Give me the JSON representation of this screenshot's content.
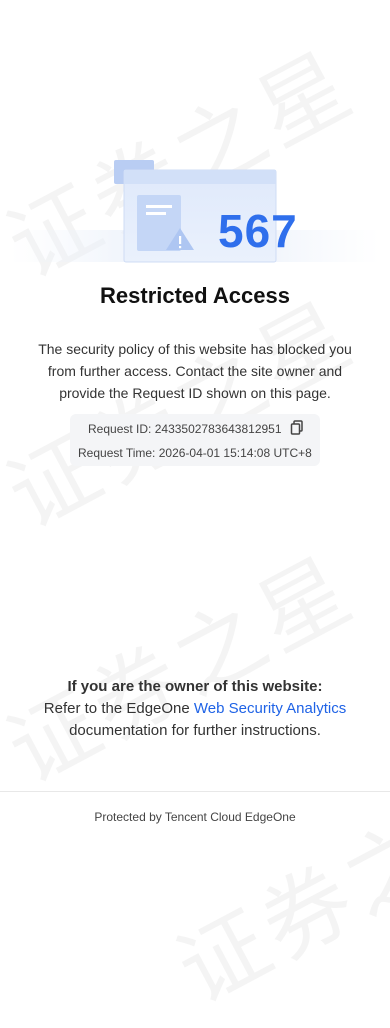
{
  "watermark": "证券之星",
  "error": {
    "code": "567",
    "title": "Restricted Access",
    "description": "The security policy of this website has blocked you from further access. Contact the site owner and provide the Request ID shown on this page."
  },
  "request": {
    "id_label": "Request ID:",
    "id_value": "2433502783643812951",
    "time_label": "Request Time:",
    "time_value": "2026-04-01 15:14:08 UTC+8",
    "copy_icon": "copy-icon"
  },
  "owner": {
    "heading": "If you are the owner of this website:",
    "prefix": "Refer to the EdgeOne",
    "link_text": "Web Security Analytics",
    "suffix": "documentation for further instructions."
  },
  "footer": {
    "text": "Protected by Tencent Cloud EdgeOne"
  },
  "colors": {
    "accent": "#2f6fec",
    "link": "#1f63e6"
  }
}
